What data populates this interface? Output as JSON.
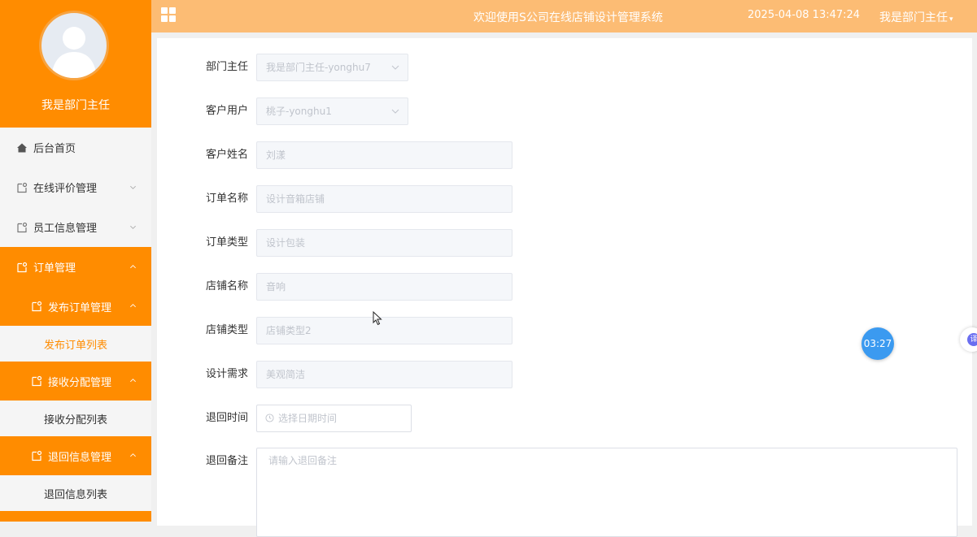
{
  "profile": {
    "name": "我是部门主任"
  },
  "sidebar": {
    "items": [
      {
        "label": "后台首页"
      },
      {
        "label": "在线评价管理"
      },
      {
        "label": "员工信息管理"
      },
      {
        "label": "订单管理"
      },
      {
        "label": "发布订单管理"
      },
      {
        "label": "发布订单列表"
      },
      {
        "label": "接收分配管理"
      },
      {
        "label": "接收分配列表"
      },
      {
        "label": "退回信息管理"
      },
      {
        "label": "退回信息列表"
      }
    ]
  },
  "header": {
    "title": "欢迎使用S公司在线店铺设计管理系统",
    "datetime": "2025-04-08 13:47:24",
    "user": "我是部门主任"
  },
  "form": {
    "fields": [
      {
        "label": "部门主任",
        "value": "我是部门主任-yonghu7"
      },
      {
        "label": "客户用户",
        "value": "桃子-yonghu1"
      },
      {
        "label": "客户姓名",
        "value": "刘漾"
      },
      {
        "label": "订单名称",
        "value": "设计音箱店铺"
      },
      {
        "label": "订单类型",
        "value": "设计包装"
      },
      {
        "label": "店铺名称",
        "value": "音响"
      },
      {
        "label": "店铺类型",
        "value": "店铺类型2"
      },
      {
        "label": "设计需求",
        "value": "美观简洁"
      },
      {
        "label": "退回时间",
        "placeholder": "选择日期时间"
      },
      {
        "label": "退回备注",
        "placeholder": "请输入退回备注"
      }
    ]
  },
  "timer": {
    "text": "03:27"
  },
  "side_tab": {
    "text": "译"
  },
  "colors": {
    "brand": "#ff8c00",
    "header": "#fcbc74",
    "timer": "#3b9af0"
  }
}
